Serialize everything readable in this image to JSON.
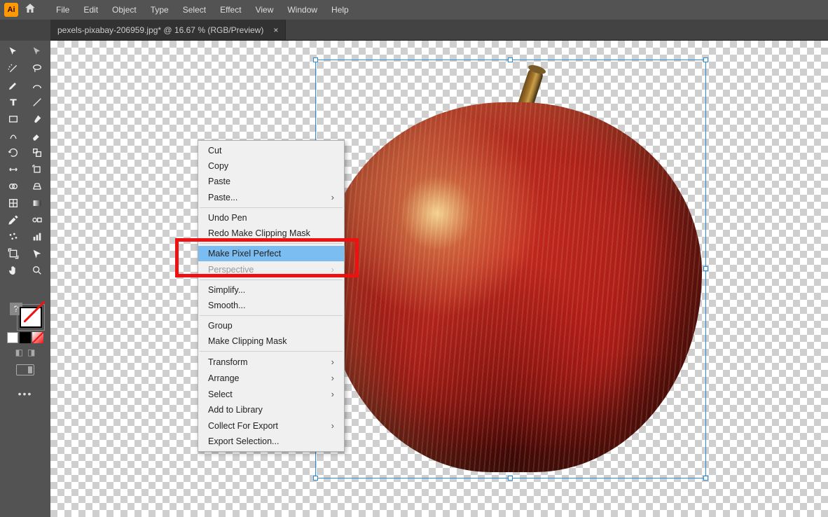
{
  "menubar": {
    "items": [
      "File",
      "Edit",
      "Object",
      "Type",
      "Select",
      "Effect",
      "View",
      "Window",
      "Help"
    ]
  },
  "tab": {
    "title": "pexels-pixabay-206959.jpg* @ 16.67 % (RGB/Preview)",
    "close": "×"
  },
  "context_menu": {
    "groups": [
      [
        {
          "label": "Cut"
        },
        {
          "label": "Copy"
        },
        {
          "label": "Paste"
        },
        {
          "label": "Paste...",
          "submenu": true
        }
      ],
      [
        {
          "label": "Undo Pen"
        },
        {
          "label": "Redo Make Clipping Mask"
        }
      ],
      [
        {
          "label": "Make Pixel Perfect",
          "highlight": true
        },
        {
          "label": "Perspective",
          "submenu": true,
          "disabled": true
        }
      ],
      [
        {
          "label": "Simplify..."
        },
        {
          "label": "Smooth..."
        }
      ],
      [
        {
          "label": "Group"
        },
        {
          "label": "Make Clipping Mask"
        }
      ],
      [
        {
          "label": "Transform",
          "submenu": true
        },
        {
          "label": "Arrange",
          "submenu": true
        },
        {
          "label": "Select",
          "submenu": true
        },
        {
          "label": "Add to Library"
        },
        {
          "label": "Collect For Export",
          "submenu": true
        },
        {
          "label": "Export Selection..."
        }
      ]
    ]
  },
  "tools": {
    "question": "?"
  },
  "app": {
    "ai": "Ai"
  }
}
